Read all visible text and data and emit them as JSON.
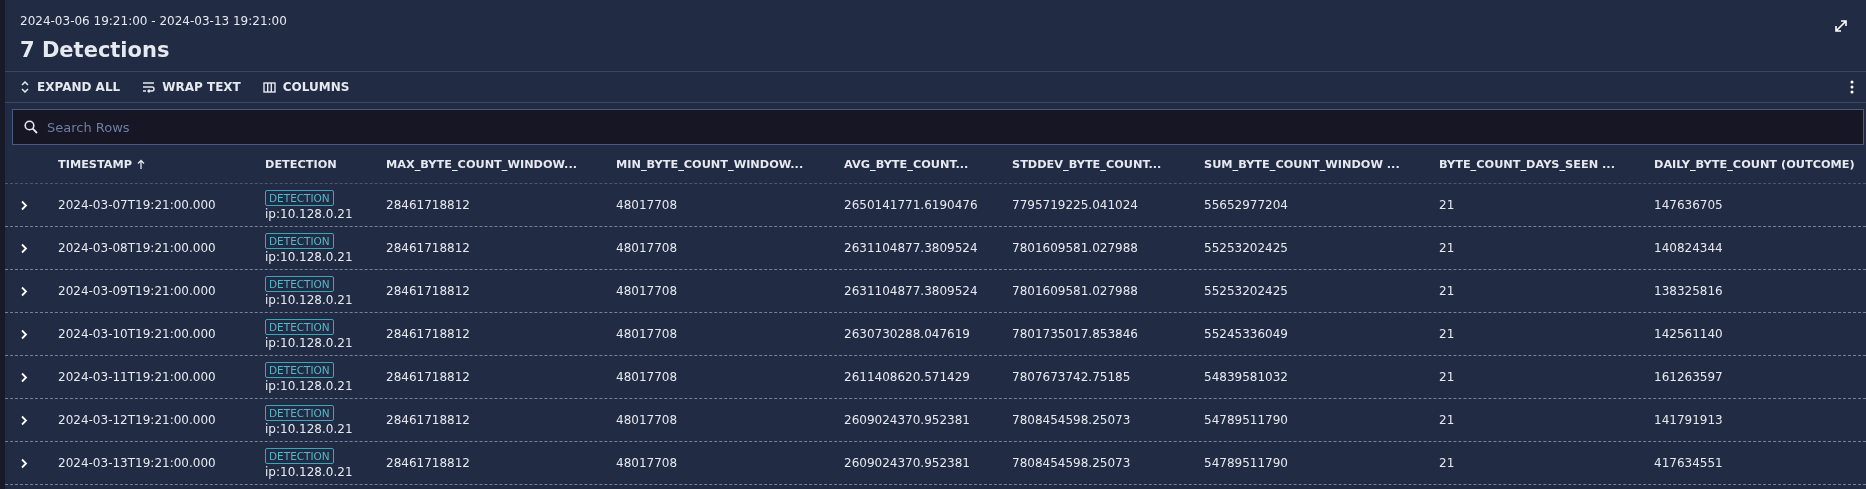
{
  "date_range": "2024-03-06 19:21:00 - 2024-03-13 19:21:00",
  "title": "7 Detections",
  "toolbar": [
    {
      "kind": "expand",
      "label": "EXPAND ALL"
    },
    {
      "kind": "wrap",
      "label": "WRAP TEXT"
    },
    {
      "kind": "columns",
      "label": "COLUMNS"
    }
  ],
  "search": {
    "placeholder": "Search Rows"
  },
  "columns": [
    {
      "label": "TIMESTAMP",
      "sorted": true
    },
    {
      "label": "DETECTION",
      "sorted": false
    },
    {
      "label": "MAX_BYTE_COUNT_WINDOW...",
      "sorted": false
    },
    {
      "label": "MIN_BYTE_COUNT_WINDOW...",
      "sorted": false
    },
    {
      "label": "AVG_BYTE_COUNT...",
      "sorted": false
    },
    {
      "label": "STDDEV_BYTE_COUNT...",
      "sorted": false
    },
    {
      "label": "SUM_BYTE_COUNT_WINDOW ...",
      "sorted": false
    },
    {
      "label": "BYTE_COUNT_DAYS_SEEN ...",
      "sorted": false
    },
    {
      "label": "DAILY_BYTE_COUNT (OUTCOME)",
      "sorted": false
    }
  ],
  "rows": [
    {
      "expanded": false,
      "timestamp": "2024-03-07T19:21:00.000",
      "tag": "DETECTION",
      "detection": "ip:10.128.0.21",
      "values": [
        "28461718812",
        "48017708",
        "2650141771.6190476",
        "7795719225.041024",
        "55652977204",
        "21",
        "147636705"
      ]
    },
    {
      "expanded": false,
      "timestamp": "2024-03-08T19:21:00.000",
      "tag": "DETECTION",
      "detection": "ip:10.128.0.21",
      "values": [
        "28461718812",
        "48017708",
        "2631104877.3809524",
        "7801609581.027988",
        "55253202425",
        "21",
        "140824344"
      ]
    },
    {
      "expanded": false,
      "timestamp": "2024-03-09T19:21:00.000",
      "tag": "DETECTION",
      "detection": "ip:10.128.0.21",
      "values": [
        "28461718812",
        "48017708",
        "2631104877.3809524",
        "7801609581.027988",
        "55253202425",
        "21",
        "138325816"
      ]
    },
    {
      "expanded": false,
      "timestamp": "2024-03-10T19:21:00.000",
      "tag": "DETECTION",
      "detection": "ip:10.128.0.21",
      "values": [
        "28461718812",
        "48017708",
        "2630730288.047619",
        "7801735017.853846",
        "55245336049",
        "21",
        "142561140"
      ]
    },
    {
      "expanded": false,
      "timestamp": "2024-03-11T19:21:00.000",
      "tag": "DETECTION",
      "detection": "ip:10.128.0.21",
      "values": [
        "28461718812",
        "48017708",
        "2611408620.571429",
        "7807673742.75185",
        "54839581032",
        "21",
        "161263597"
      ]
    },
    {
      "expanded": false,
      "timestamp": "2024-03-12T19:21:00.000",
      "tag": "DETECTION",
      "detection": "ip:10.128.0.21",
      "values": [
        "28461718812",
        "48017708",
        "2609024370.952381",
        "7808454598.25073",
        "54789511790",
        "21",
        "141791913"
      ]
    },
    {
      "expanded": false,
      "timestamp": "2024-03-13T19:21:00.000",
      "tag": "DETECTION",
      "detection": "ip:10.128.0.21",
      "values": [
        "28461718812",
        "48017708",
        "2609024370.952381",
        "7808454598.25073",
        "54789511790",
        "21",
        "417634551"
      ]
    }
  ]
}
